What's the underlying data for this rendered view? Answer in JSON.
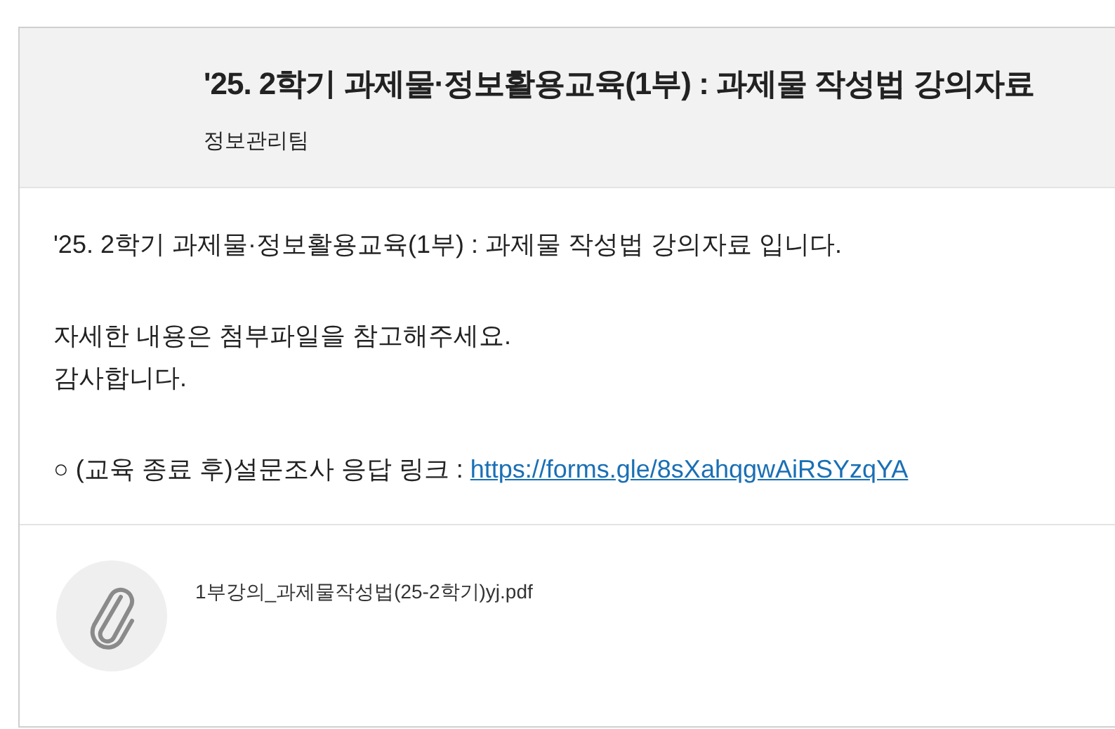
{
  "post": {
    "title": "'25. 2학기 과제물·정보활용교육(1부) : 과제물 작성법 강의자료",
    "author": "정보관리팀"
  },
  "body": {
    "paragraphs": [
      {
        "kind": "text",
        "lines": [
          "'25. 2학기 과제물·정보활용교육(1부) : 과제물 작성법 강의자료 입니다."
        ]
      },
      {
        "kind": "text",
        "lines": [
          "자세한 내용은 첨부파일을 참고해주세요.",
          "감사합니다."
        ]
      },
      {
        "kind": "link",
        "text": "○ (교육 종료 후)설문조사 응답 링크 : ",
        "link": "https://forms.gle/8sXahqgwAiRSYzqYA"
      }
    ]
  },
  "attachments": [
    {
      "filename": "1부강의_과제물작성법(25-2학기)yj.pdf"
    }
  ]
}
